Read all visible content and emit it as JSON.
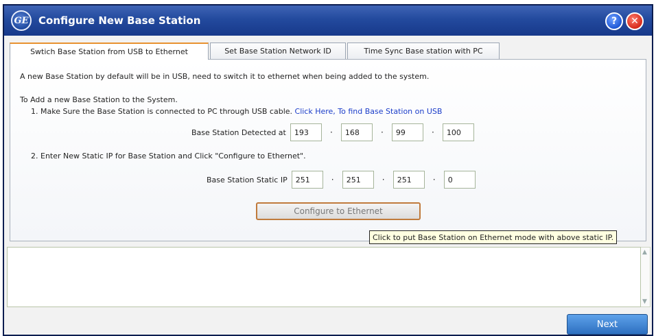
{
  "window": {
    "title": "Configure New Base Station",
    "logo_text": "GE",
    "help_label": "?",
    "close_label": "✕"
  },
  "tabs": [
    {
      "label": "Swtich Base Station from USB to Ethernet",
      "active": true
    },
    {
      "label": "Set Base Station Network ID",
      "active": false
    },
    {
      "label": "Time Sync Base station with PC",
      "active": false
    }
  ],
  "panel": {
    "intro": "A new Base Station by default will be in USB, need to switch it to ethernet when being added to the system.",
    "heading": "To Add a new Base Station to the System.",
    "step1": "1. Make Sure the Base Station is connected to PC through USB cable.",
    "step1_link": "Click Here, To find Base Station on USB",
    "detected_label": "Base Station Detected at",
    "detected_ip": [
      "193",
      "168",
      "99",
      "100"
    ],
    "step2": "2. Enter New Static IP for Base Station and Click \"Configure to Ethernet\".",
    "static_label": "Base Station Static IP",
    "static_ip": [
      "251",
      "251",
      "251",
      "0"
    ],
    "ip_separator": "·",
    "configure_button": "Configure to Ethernet",
    "tooltip": "Click to put Base Station on Ethernet mode with above static IP."
  },
  "log": {
    "value": ""
  },
  "footer": {
    "next_button": "Next"
  }
}
